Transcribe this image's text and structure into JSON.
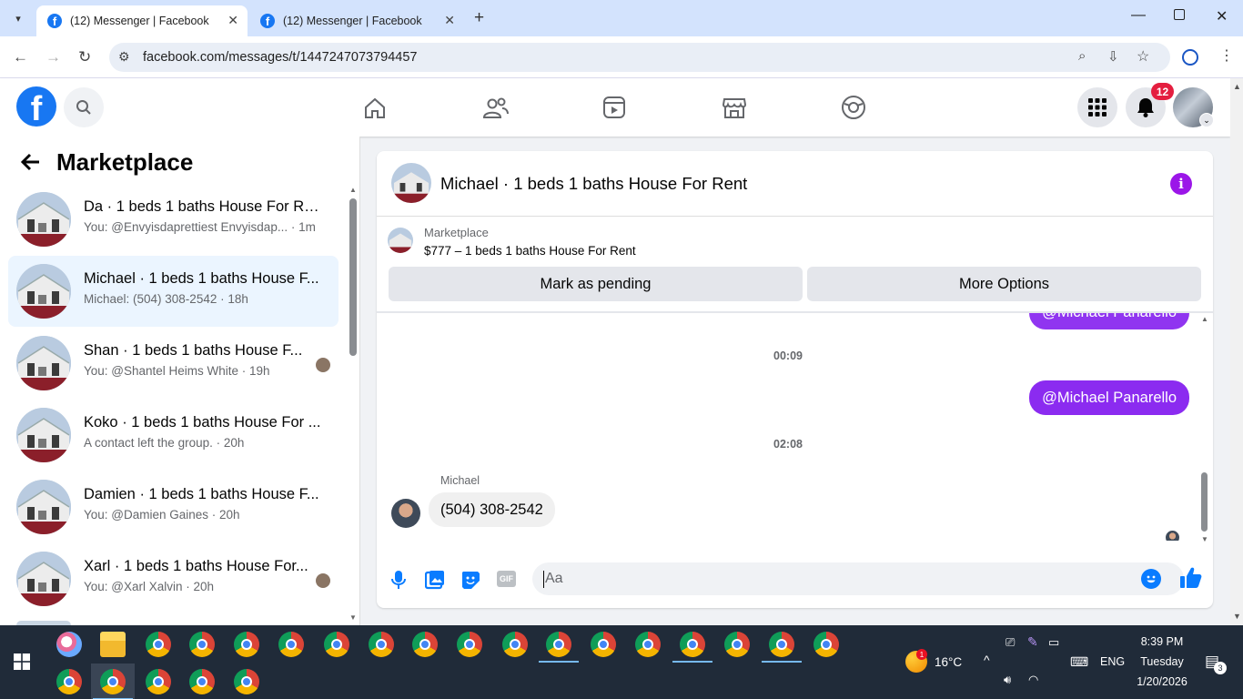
{
  "browser": {
    "tabs": [
      {
        "title": "(12) Messenger | Facebook",
        "active": true
      },
      {
        "title": "(12) Messenger | Facebook",
        "active": false
      }
    ],
    "url": "facebook.com/messages/t/1447247073794457"
  },
  "fb": {
    "logo": "f",
    "notification_count": "12"
  },
  "sidebar": {
    "title": "Marketplace",
    "conversations": [
      {
        "title": "Da · 1 beds 1 baths House For Rent",
        "subtitle": "You: @Envyisdaprettiest Envyisdap... · 1m",
        "selected": false,
        "has_mini_avatar": false
      },
      {
        "title": "Michael · 1 beds 1 baths House F...",
        "subtitle": "Michael: (504) 308-2542 · 18h",
        "selected": true,
        "has_mini_avatar": false
      },
      {
        "title": "Shan · 1 beds 1 baths House F...",
        "subtitle": "You: @Shantel Heims White · 19h",
        "selected": false,
        "has_mini_avatar": true
      },
      {
        "title": "Koko · 1 beds 1 baths House For ...",
        "subtitle": "A contact left the group. · 20h",
        "selected": false,
        "has_mini_avatar": false
      },
      {
        "title": "Damien · 1 beds 1 baths House F...",
        "subtitle": "You: @Damien Gaines · 20h",
        "selected": false,
        "has_mini_avatar": false
      },
      {
        "title": "Xarl · 1 beds 1 baths House For...",
        "subtitle": "You: @Xarl Xalvin · 20h",
        "selected": false,
        "has_mini_avatar": true
      }
    ]
  },
  "chat": {
    "header_title": "Michael · 1 beds 1 baths House For Rent",
    "listing_label": "Marketplace",
    "listing_title": "$777 – 1 beds 1 baths House For Rent",
    "mark_pending": "Mark as pending",
    "more_options": "More Options",
    "messages": {
      "top_partial": "@Michael Panarello",
      "time1": "00:09",
      "outgoing": "@Michael Panarello",
      "time2": "02:08",
      "sender": "Michael",
      "incoming": "(504) 308-2542"
    },
    "composer_placeholder": "Aa",
    "accent": "#8b2bf0"
  },
  "taskbar": {
    "weather": "16°C",
    "weather_badge": "1",
    "lang": "ENG",
    "time": "8:39 PM",
    "day": "Tuesday",
    "date": "1/20/2026",
    "notif": "3"
  }
}
